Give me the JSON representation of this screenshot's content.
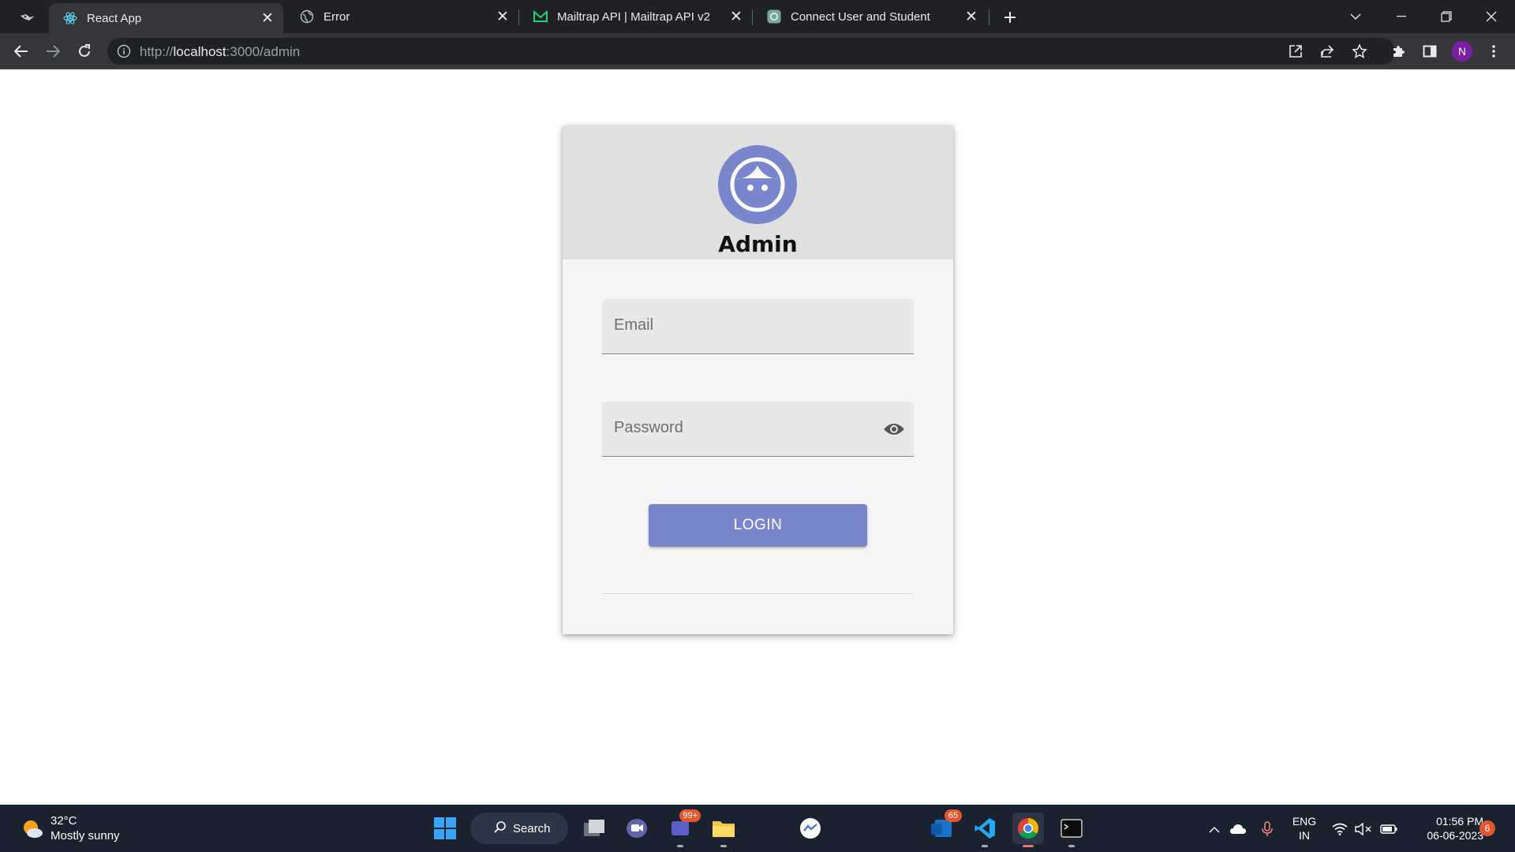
{
  "browser": {
    "tabs": [
      {
        "title": "React App",
        "icon": "react-icon",
        "active": true
      },
      {
        "title": "Error",
        "icon": "globe-icon",
        "active": false
      },
      {
        "title": "Mailtrap API | Mailtrap API v2",
        "icon": "mailtrap-icon",
        "active": false
      },
      {
        "title": "Connect User and Student",
        "icon": "chatgpt-icon",
        "active": false
      }
    ],
    "address": {
      "scheme": "http://",
      "host": "localhost",
      "rest": ":3000/admin"
    },
    "profile_initial": "N"
  },
  "login_card": {
    "title": "Admin",
    "email_placeholder": "Email",
    "password_placeholder": "Password",
    "login_label": "LOGIN",
    "accent_color": "#7986cb"
  },
  "taskbar": {
    "weather": {
      "temp": "32°C",
      "condition": "Mostly sunny"
    },
    "search_label": "Search",
    "badges": {
      "teams": "99+",
      "mail": "65",
      "notifications": "6"
    },
    "lang": {
      "line1": "ENG",
      "line2": "IN"
    },
    "clock": {
      "time": "01:56 PM",
      "date": "06-06-2023"
    }
  }
}
